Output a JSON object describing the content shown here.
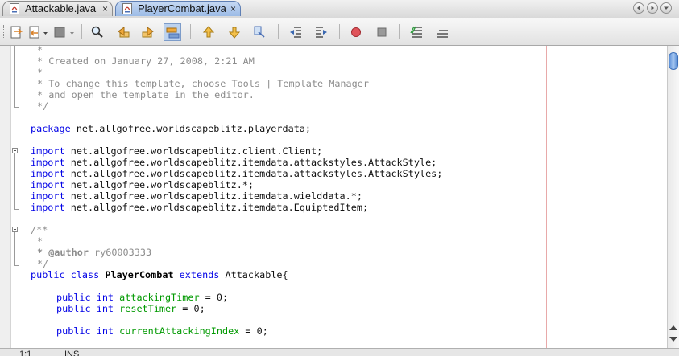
{
  "tabs": [
    {
      "label": "Attackable.java",
      "active": false,
      "close": "×"
    },
    {
      "label": "PlayerCombat.java",
      "active": true,
      "close": "×"
    }
  ],
  "toolbar_icons": [
    "last-edit-icon",
    "back-icon",
    "forward-icon",
    "find-icon",
    "find-previous-icon",
    "find-next-icon",
    "toggle-highlight-icon",
    "previous-bookmark-icon",
    "next-bookmark-icon",
    "toggle-bookmark-icon",
    "shift-left-icon",
    "shift-right-icon",
    "record-macro-icon",
    "stop-macro-icon",
    "comment-icon",
    "uncomment-icon"
  ],
  "code": {
    "l1": "*",
    "l2": "* Created on January 27, 2008, 2:21 AM",
    "l3": "*",
    "l4": "* To change this template, choose Tools | Template Manager",
    "l5": "* and open the template in the editor.",
    "l6": "*/",
    "pkg_kw": "package",
    "pkg_name": " net.allgofree.worldscapeblitz.playerdata;",
    "import_kw": "import",
    "imports": [
      " net.allgofree.worldscapeblitz.client.Client;",
      " net.allgofree.worldscapeblitz.itemdata.attackstyles.AttackStyle;",
      " net.allgofree.worldscapeblitz.itemdata.attackstyles.AttackStyles;",
      " net.allgofree.worldscapeblitz.*;",
      " net.allgofree.worldscapeblitz.itemdata.wielddata.*;",
      " net.allgofree.worldscapeblitz.itemdata.EquiptedItem;"
    ],
    "doc_open": "/**",
    "doc_star": "*",
    "doc_star2": "*",
    "author_tag": "* @author",
    "author_name": " ry60003333",
    "doc_close": "*/",
    "cls_public": "public",
    "cls_class": " class ",
    "cls_name": "PlayerCombat",
    "cls_extends": " extends ",
    "cls_parent": "Attackable{",
    "f1_public": "public",
    "f1_int": " int ",
    "f1_name": "attackingTimer",
    "f1_rest": " = 0;",
    "f2_public": "public",
    "f2_int": " int ",
    "f2_name": "resetTimer",
    "f2_rest": " = 0;",
    "f3_public": "public",
    "f3_int": " int ",
    "f3_name": "currentAttackingIndex",
    "f3_rest": " = 0;"
  },
  "status": {
    "position": "1:1",
    "mode": "INS"
  }
}
